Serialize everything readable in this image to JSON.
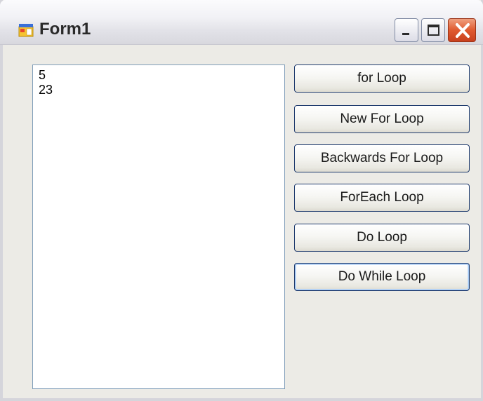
{
  "window": {
    "title": "Form1"
  },
  "textbox": {
    "lines": [
      "5",
      "23"
    ]
  },
  "buttons": [
    {
      "label": "for Loop"
    },
    {
      "label": "New For Loop"
    },
    {
      "label": "Backwards For Loop"
    },
    {
      "label": "ForEach Loop"
    },
    {
      "label": "Do Loop"
    },
    {
      "label": "Do While Loop"
    }
  ],
  "icons": {
    "app": "form-app-icon",
    "minimize": "minimize-icon",
    "maximize": "maximize-icon",
    "close": "close-icon"
  },
  "colors": {
    "close_button": "#e05a30",
    "textbox_border": "#7f9db9",
    "button_border": "#1f3b6e"
  }
}
